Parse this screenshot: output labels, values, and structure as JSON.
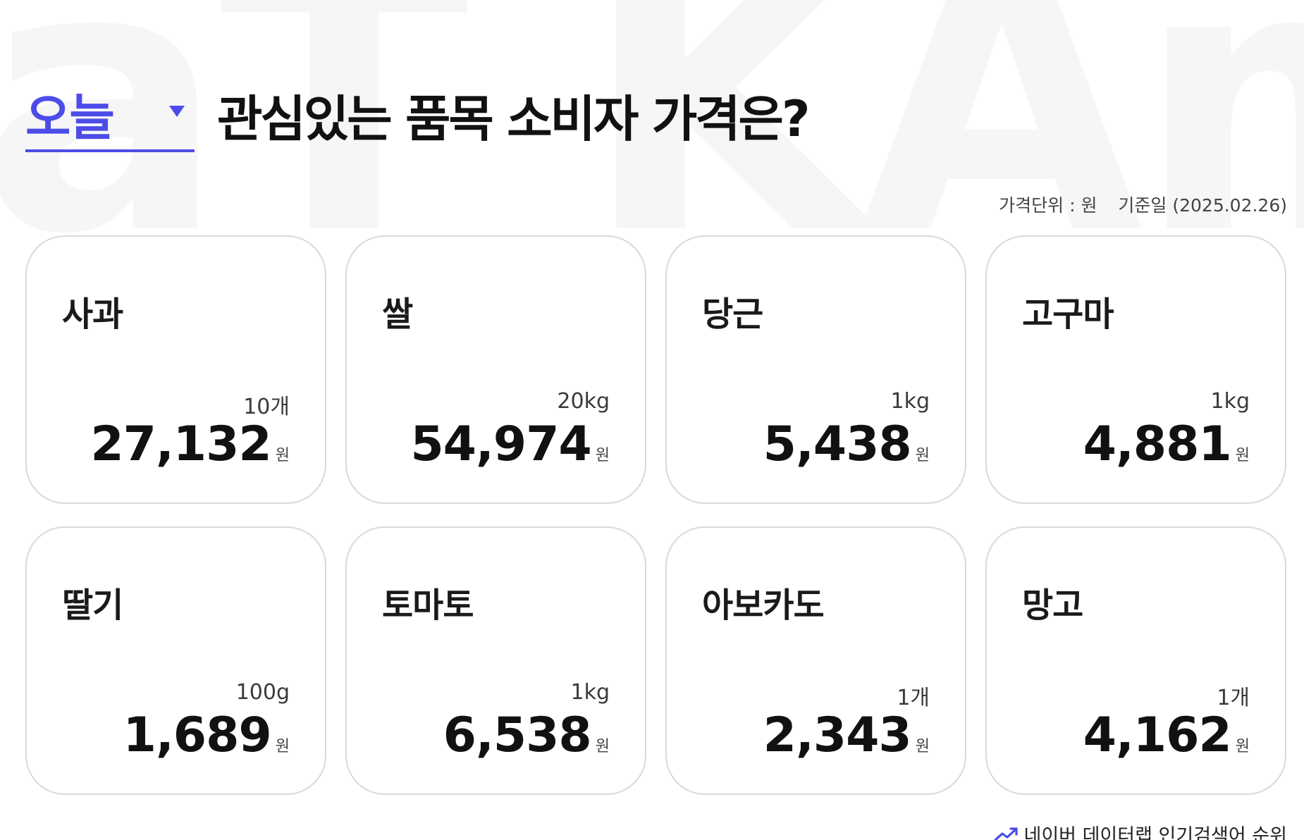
{
  "watermark": "aT KAmis",
  "header": {
    "period_selected": "오늘",
    "title": "관심있는 품목 소비자 가격은?"
  },
  "meta": {
    "price_unit": "가격단위 : 원",
    "reference_date": "기준일 (2025.02.26)"
  },
  "items": [
    {
      "name": "사과",
      "unit": "10개",
      "price": "27,132",
      "currency": "원"
    },
    {
      "name": "쌀",
      "unit": "20kg",
      "price": "54,974",
      "currency": "원"
    },
    {
      "name": "당근",
      "unit": "1kg",
      "price": "5,438",
      "currency": "원"
    },
    {
      "name": "고구마",
      "unit": "1kg",
      "price": "4,881",
      "currency": "원"
    },
    {
      "name": "딸기",
      "unit": "100g",
      "price": "1,689",
      "currency": "원"
    },
    {
      "name": "토마토",
      "unit": "1kg",
      "price": "6,538",
      "currency": "원"
    },
    {
      "name": "아보카도",
      "unit": "1개",
      "price": "2,343",
      "currency": "원"
    },
    {
      "name": "망고",
      "unit": "1개",
      "price": "4,162",
      "currency": "원"
    }
  ],
  "footer": {
    "link_label": "네이버 데이터랩 인기검색어 순위",
    "icon": "trending-up-icon"
  },
  "colors": {
    "accent": "#4c4ce8",
    "card_border": "#d9d9d9",
    "text": "#111111"
  }
}
